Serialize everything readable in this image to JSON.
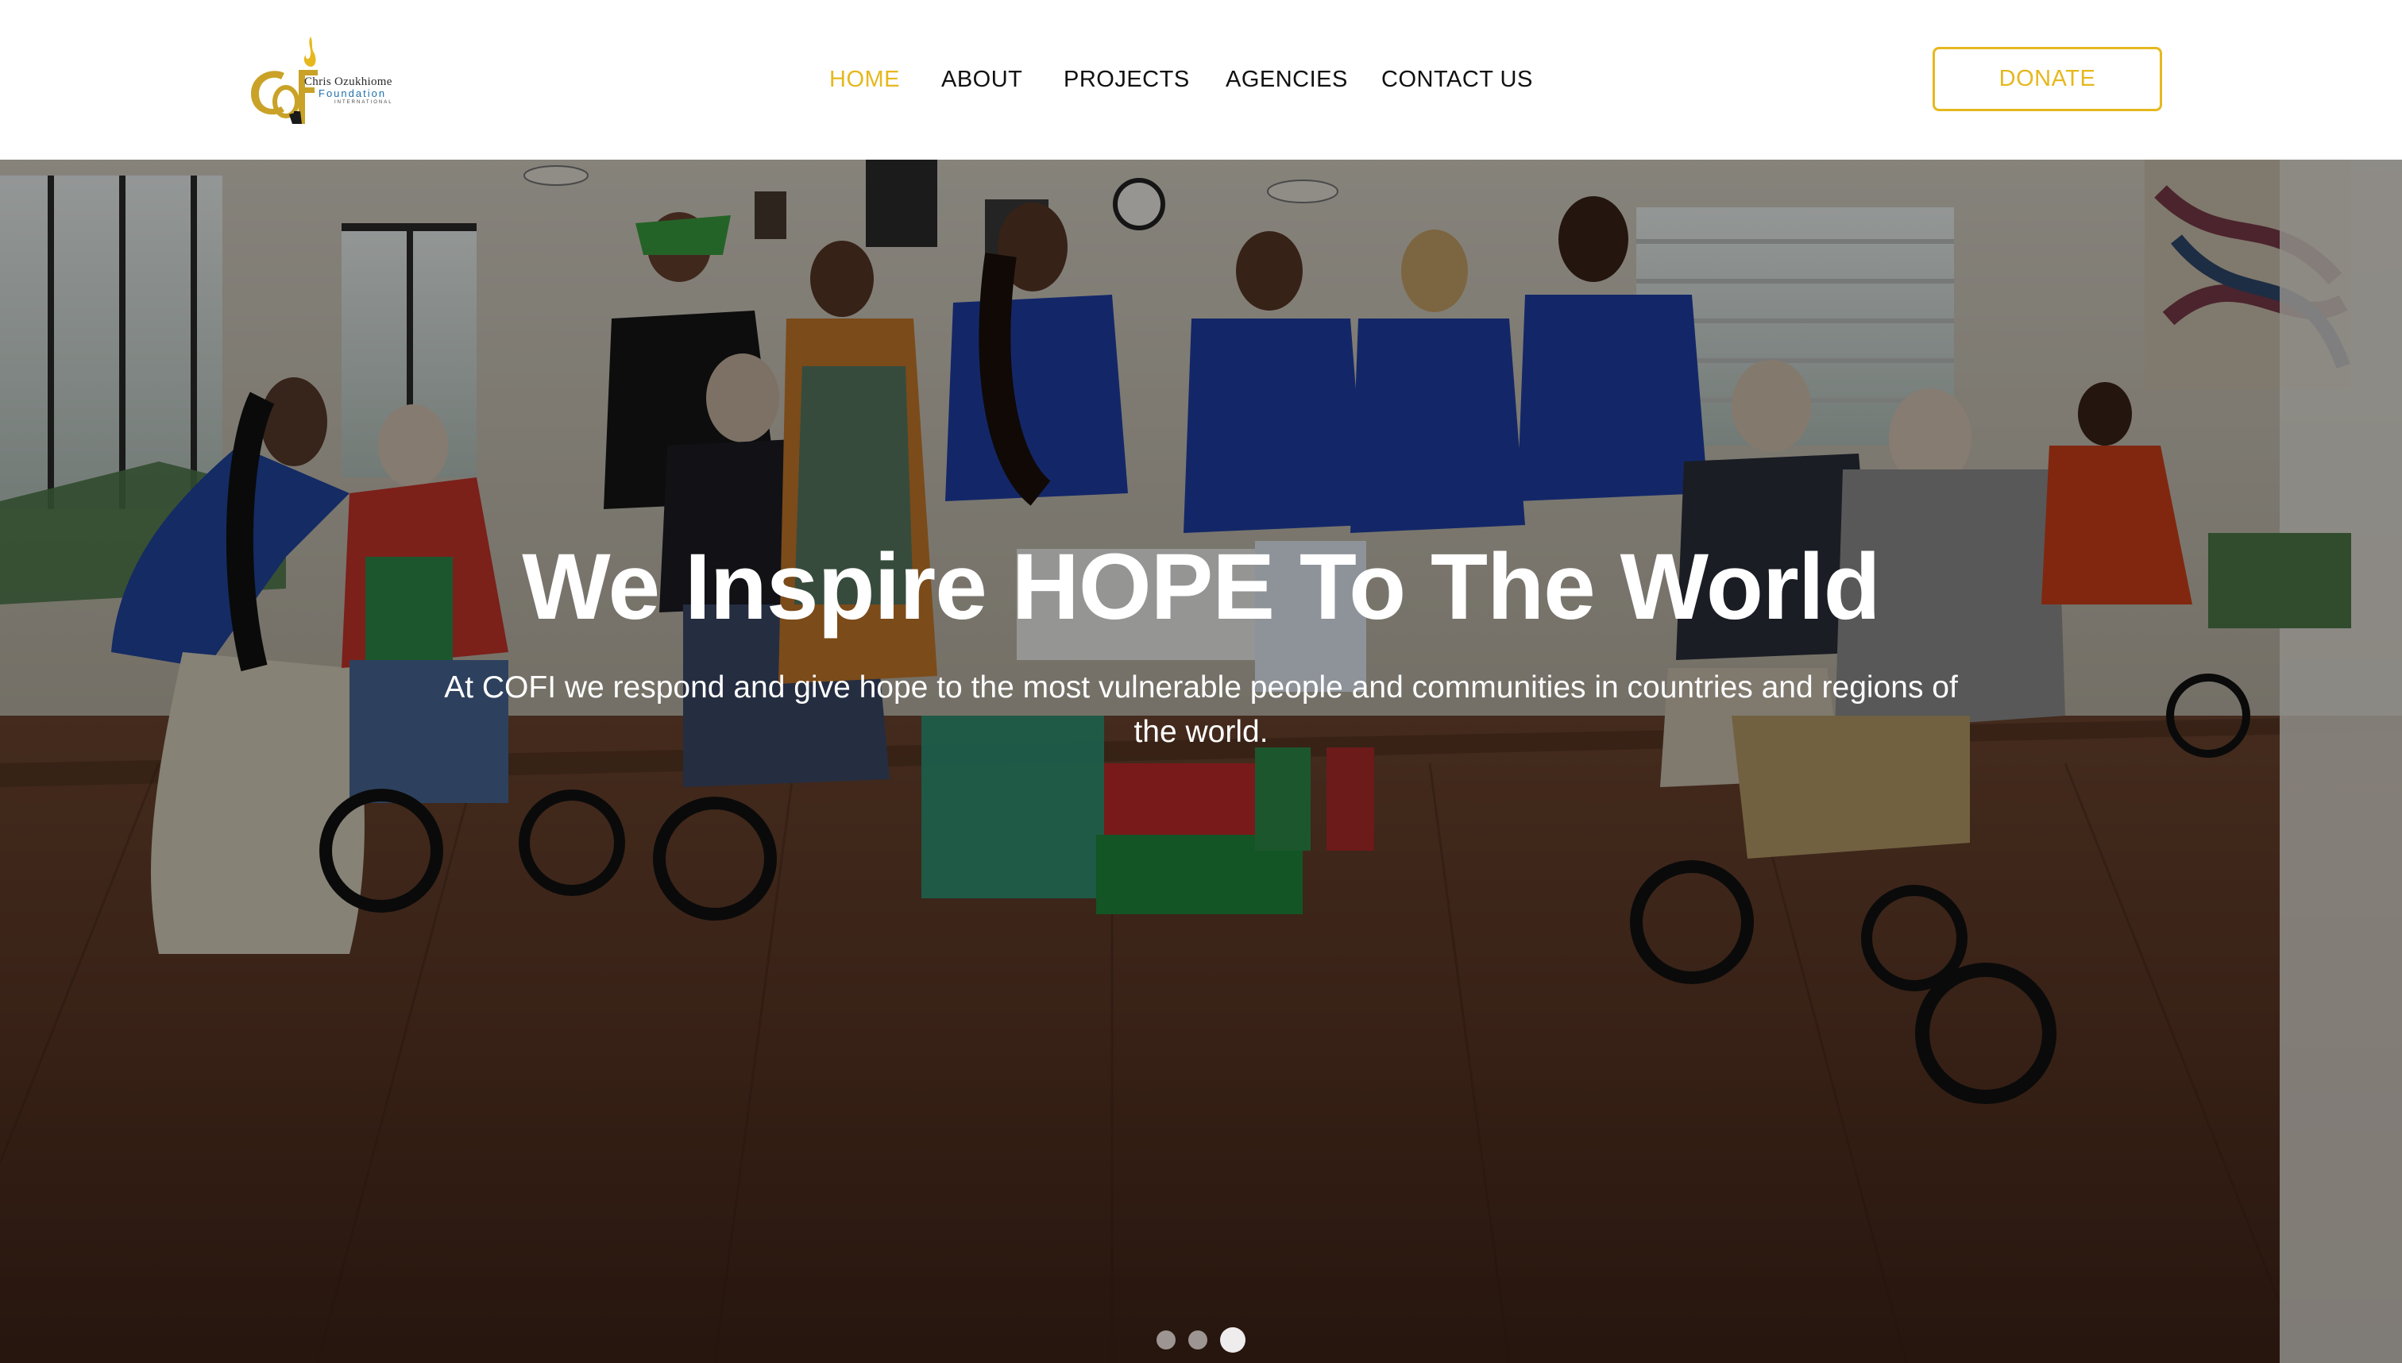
{
  "logo": {
    "monogram": "COFI",
    "line1": "Chris Ozukhiome",
    "line2": "Foundation",
    "line3": "INTERNATIONAL"
  },
  "nav": {
    "home": "HOME",
    "about": "ABOUT",
    "projects": "PROJECTS",
    "agencies": "AGENCIES",
    "contact": "CONTACT US",
    "active": "home"
  },
  "donate_label": "DONATE",
  "hero": {
    "title": "We Inspire HOPE To The World",
    "subtitle": "At COFI we respond and give hope to the most vulnerable people and communities in countries and regions of the world.",
    "slides_total": 3,
    "active_slide": 3
  },
  "colors": {
    "accent": "#e6b81e",
    "nav_text": "#111111",
    "hero_text": "#ffffff"
  }
}
